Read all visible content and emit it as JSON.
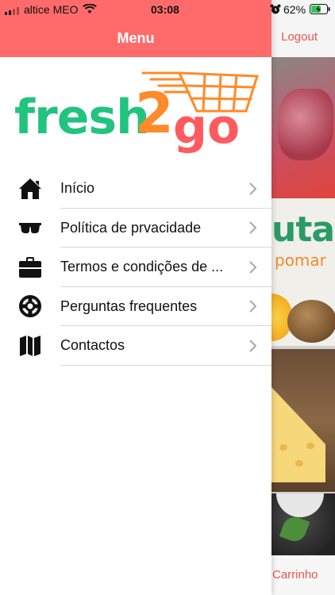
{
  "status_bar": {
    "carrier": "altice MEO",
    "time": "03:08",
    "battery": "62%"
  },
  "background": {
    "logout_label": "Logout",
    "banner_title": "uta",
    "banner_subtitle": "pomar",
    "cart_label": "Carrinho"
  },
  "drawer": {
    "title": "Menu",
    "logo": {
      "part1": "fresh",
      "part2": "2",
      "part3": "go"
    },
    "items": [
      {
        "label": "Início",
        "icon": "home-icon"
      },
      {
        "label": "Política de prvacidade",
        "icon": "sunglasses-icon"
      },
      {
        "label": "Termos e condições de ...",
        "icon": "briefcase-icon"
      },
      {
        "label": "Perguntas frequentes",
        "icon": "lifebuoy-icon"
      },
      {
        "label": "Contactos",
        "icon": "map-icon"
      }
    ]
  },
  "colors": {
    "header": "#ff6b6b",
    "accent_red": "#ef5350",
    "logo_green": "#22c37f",
    "logo_orange": "#ff8a2a",
    "logo_red": "#ff5a5f"
  }
}
